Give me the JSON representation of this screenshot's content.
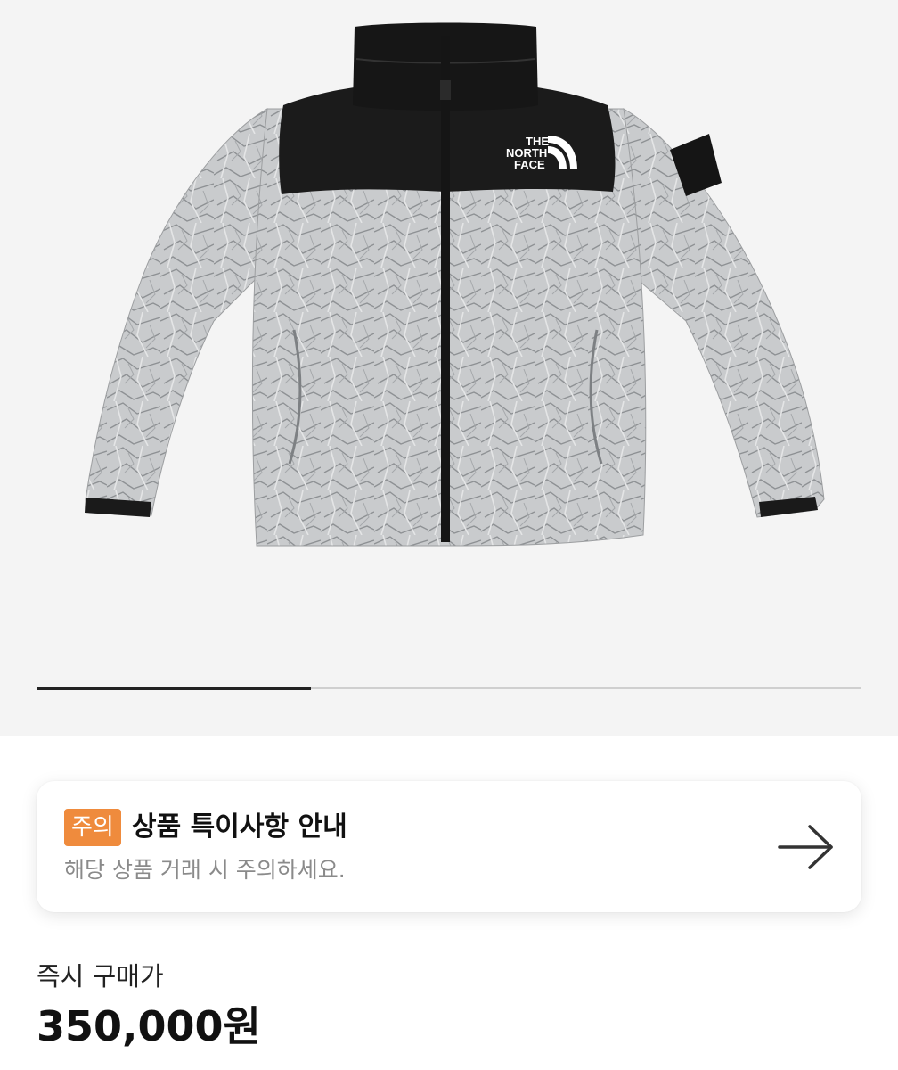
{
  "product": {
    "image_alt": "The North Face Nuptse jacket, black shoulders and paper-print body",
    "logo_lines": [
      "THE",
      "NORTH",
      "FACE"
    ],
    "carousel": {
      "current_index": 0,
      "progress_fraction": 0.333
    }
  },
  "notice": {
    "badge": "주의",
    "title": "상품 특이사항 안내",
    "subtitle": "해당 상품 거래 시 주의하세요.",
    "arrow_icon": "arrow-right-icon",
    "badge_color": "#ef8b3d"
  },
  "price": {
    "label": "즉시 구매가",
    "value": "350,000원"
  }
}
